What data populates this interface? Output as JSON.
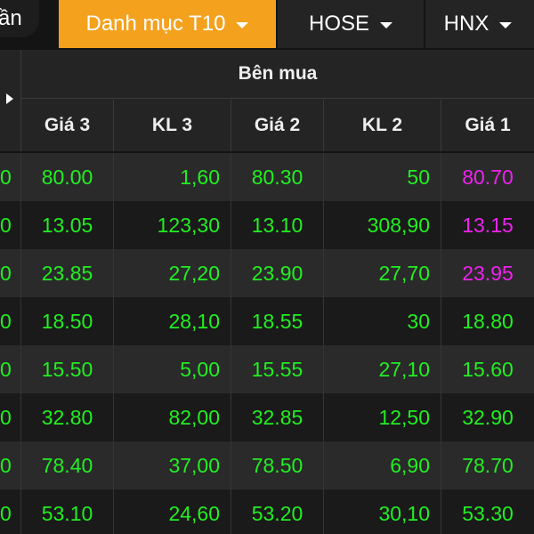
{
  "tabs": {
    "partial_label": "ần",
    "active_label": "Danh mục T10",
    "hose_label": "HOSE",
    "hnx_label": "HNX"
  },
  "colors": {
    "accent": "#f4a11d",
    "up": "#22ee22",
    "ceiling": "#ee22ee"
  },
  "table": {
    "group_title": "Bên mua",
    "headers": [
      "Giá 3",
      "KL 3",
      "Giá 2",
      "KL 2",
      "Giá 1"
    ],
    "rows": [
      {
        "stub": "0",
        "cells": [
          "80.00",
          "1,60",
          "80.30",
          "50",
          "80.70"
        ],
        "last_color": "#ee22ee"
      },
      {
        "stub": "0",
        "cells": [
          "13.05",
          "123,30",
          "13.10",
          "308,90",
          "13.15"
        ],
        "last_color": "#ee22ee"
      },
      {
        "stub": "0",
        "cells": [
          "23.85",
          "27,20",
          "23.90",
          "27,70",
          "23.95"
        ],
        "last_color": "#ee22ee"
      },
      {
        "stub": "0",
        "cells": [
          "18.50",
          "28,10",
          "18.55",
          "30",
          "18.80"
        ],
        "last_color": "#22ee22"
      },
      {
        "stub": "0",
        "cells": [
          "15.50",
          "5,00",
          "15.55",
          "27,10",
          "15.60"
        ],
        "last_color": "#22ee22"
      },
      {
        "stub": "0",
        "cells": [
          "32.80",
          "82,00",
          "32.85",
          "12,50",
          "32.90"
        ],
        "last_color": "#22ee22"
      },
      {
        "stub": "0",
        "cells": [
          "78.40",
          "37,00",
          "78.50",
          "6,90",
          "78.70"
        ],
        "last_color": "#22ee22"
      },
      {
        "stub": "0",
        "cells": [
          "53.10",
          "24,60",
          "53.20",
          "30,10",
          "53.30"
        ],
        "last_color": "#22ee22"
      }
    ]
  }
}
